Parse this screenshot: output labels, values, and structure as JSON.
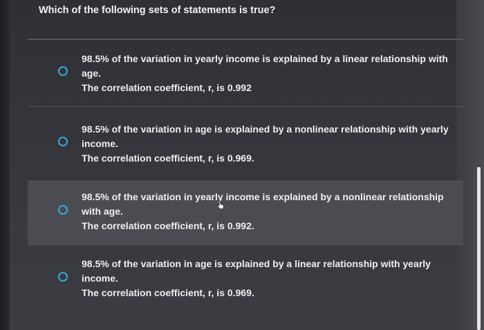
{
  "question": "Which of the following sets of statements is true?",
  "options": [
    {
      "statement": "98.5% of the variation in yearly income is explained by a linear relationship with age.",
      "correlation": "The correlation coefficient, r, is 0.992"
    },
    {
      "statement": "98.5% of the variation in age is explained by a nonlinear relationship with yearly income.",
      "correlation": "The correlation coefficient, r, is 0.969."
    },
    {
      "statement": "98.5% of the variation in yearly income is explained by a nonlinear relationship with age.",
      "correlation": "The correlation coefficient, r, is 0.992."
    },
    {
      "statement": "98.5% of the variation in age is explained by a linear relationship with yearly income.",
      "correlation": "The correlation coefficient, r, is 0.969."
    }
  ],
  "colors": {
    "radio": "#3aa8d8",
    "text": "#efefef",
    "highlight": "#4a4c51"
  },
  "icons": {
    "cursor": "hand-pointer-icon"
  }
}
